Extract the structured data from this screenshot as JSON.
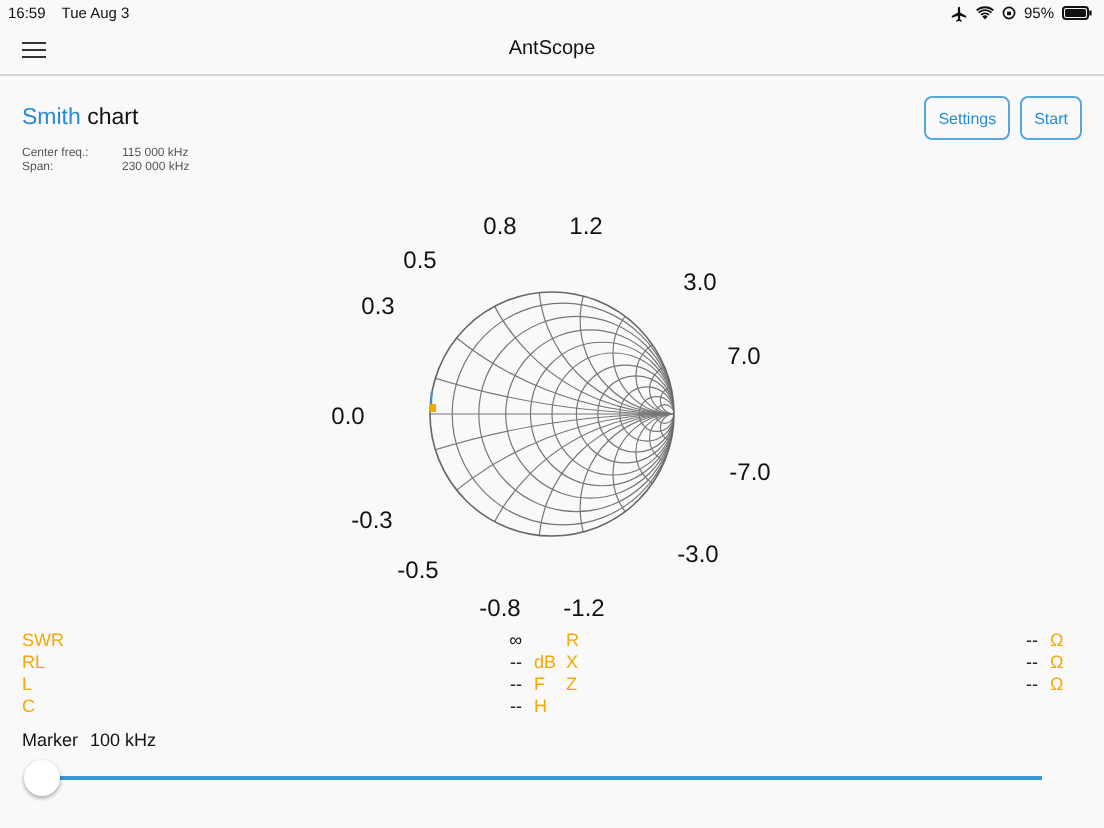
{
  "status_bar": {
    "time": "16:59",
    "date": "Tue Aug 3",
    "battery": "95%"
  },
  "nav": {
    "title": "AntScope"
  },
  "header": {
    "title_accent": "Smith",
    "title_rest": "chart",
    "buttons": [
      "Settings",
      "Start"
    ]
  },
  "info": [
    {
      "label": "Center freq.:",
      "value": "115 000 kHz"
    },
    {
      "label": "Span:",
      "value": "230 000 kHz"
    }
  ],
  "smith_chart": {
    "labels": [
      "0.8",
      "1.2",
      "0.5",
      "3.0",
      "0.3",
      "7.0",
      "0.0",
      "-7.0",
      "-0.3",
      "-3.0",
      "-0.5",
      "-0.8",
      "-1.2"
    ]
  },
  "readouts_left": [
    {
      "label": "SWR",
      "value": "∞"
    },
    {
      "label": "RL",
      "value": "--",
      "unit": "dB"
    },
    {
      "label": "L",
      "value": "--",
      "unit": "F"
    },
    {
      "label": "C",
      "value": "--",
      "unit": "H"
    }
  ],
  "readouts_right": [
    {
      "label": "R",
      "value": "--",
      "unit": "Ω"
    },
    {
      "label": "X",
      "value": "--",
      "unit": "Ω"
    },
    {
      "label": "Z",
      "value": "--",
      "unit": "Ω"
    }
  ],
  "marker": {
    "label": "Marker",
    "value": "100 kHz",
    "level": 0
  }
}
